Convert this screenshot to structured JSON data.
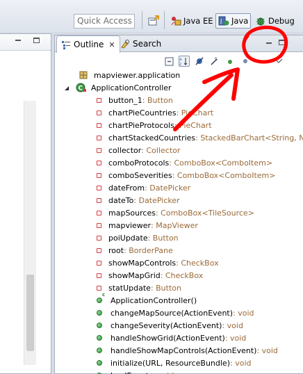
{
  "toolbar": {
    "quick_access_placeholder": "Quick Access",
    "perspectives": [
      {
        "label": "Java EE",
        "active": false
      },
      {
        "label": "Java",
        "active": true
      },
      {
        "label": "Debug",
        "active": false
      }
    ]
  },
  "outline_view": {
    "tabs": [
      {
        "label": "Outline",
        "selected": true
      },
      {
        "label": "Search",
        "selected": false
      }
    ],
    "tree": [
      {
        "kind": "package",
        "label": "mapviewer.application",
        "type": ""
      },
      {
        "kind": "class",
        "label": "ApplicationController",
        "type": ""
      },
      {
        "kind": "field",
        "label": "button_1",
        "type": " : Button"
      },
      {
        "kind": "field",
        "label": "chartPieCountries",
        "type": " : PieChart"
      },
      {
        "kind": "field",
        "label": "chartPieProtocols",
        "type": " : PieChart"
      },
      {
        "kind": "field",
        "label": "chartStackedCountries",
        "type": " : StackedBarChart<String, N"
      },
      {
        "kind": "field",
        "label": "collector",
        "type": " : Collector"
      },
      {
        "kind": "field",
        "label": "comboProtocols",
        "type": " : ComboBox<ComboItem>"
      },
      {
        "kind": "field",
        "label": "comboSeverities",
        "type": " : ComboBox<ComboItem>"
      },
      {
        "kind": "field",
        "label": "dateFrom",
        "type": " : DatePicker"
      },
      {
        "kind": "field",
        "label": "dateTo",
        "type": " : DatePicker"
      },
      {
        "kind": "field",
        "label": "mapSources",
        "type": " : ComboBox<TileSource>"
      },
      {
        "kind": "field",
        "label": "mapviewer",
        "type": " : MapViewer"
      },
      {
        "kind": "field",
        "label": "poiUpdate",
        "type": " : Button"
      },
      {
        "kind": "field",
        "label": "root",
        "type": " : BorderPane"
      },
      {
        "kind": "field",
        "label": "showMapControls",
        "type": " : CheckBox"
      },
      {
        "kind": "field",
        "label": "showMapGrid",
        "type": " : CheckBox"
      },
      {
        "kind": "field",
        "label": "statUpdate",
        "type": " : Button"
      },
      {
        "kind": "constructor",
        "label": "ApplicationController()",
        "type": ""
      },
      {
        "kind": "method",
        "label": "changeMapSource(ActionEvent)",
        "type": " : void"
      },
      {
        "kind": "method",
        "label": "changeSeverity(ActionEvent)",
        "type": " : void"
      },
      {
        "kind": "method",
        "label": "handleShowGrid(ActionEvent)",
        "type": " : void"
      },
      {
        "kind": "method",
        "label": "handleShowMapControls(ActionEvent)",
        "type": " : void"
      },
      {
        "kind": "method",
        "label": "initialize(URL, ResourceBundle)",
        "type": " : void"
      },
      {
        "kind": "method",
        "label": "loadEvents",
        "type": " : void"
      }
    ]
  },
  "colors": {
    "field_icon": "#d43c3c",
    "method_icon": "#2f9a3c",
    "type_text": "#9a6a38",
    "annotation": "#ff0000"
  }
}
